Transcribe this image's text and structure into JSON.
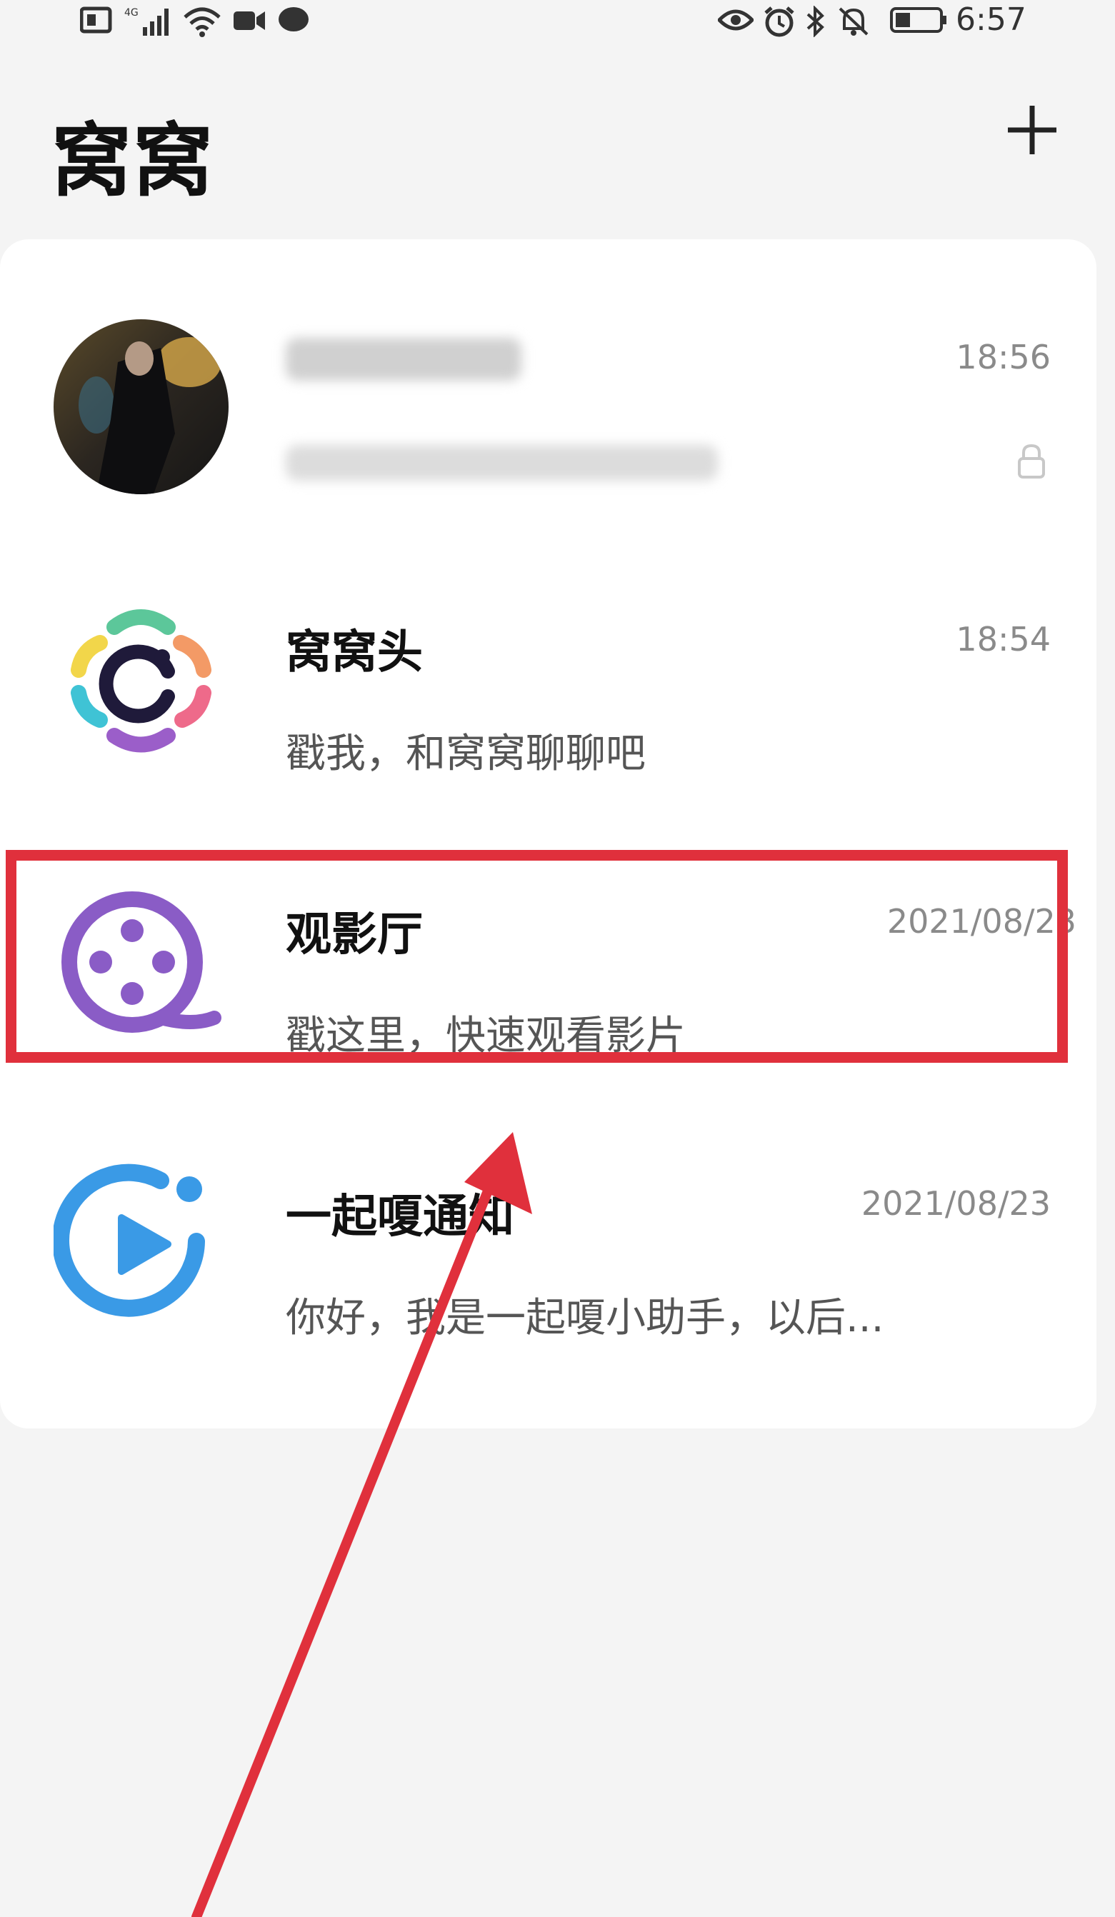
{
  "status_bar": {
    "time": "6:57"
  },
  "header": {
    "title": "窝窝"
  },
  "chats": [
    {
      "name": "",
      "time": "18:56",
      "preview": "",
      "locked": true
    },
    {
      "name": "窝窝头",
      "time": "18:54",
      "preview": "戳我，和窝窝聊聊吧"
    },
    {
      "name": "观影厅",
      "time": "2021/08/23",
      "preview": "戳这里，快速观看影片"
    },
    {
      "name": "一起嗄通知",
      "time": "2021/08/23",
      "preview": "你好，我是一起嗄小助手，以后..."
    }
  ],
  "colors": {
    "highlight": "#e0303c",
    "movie_icon": "#8a5cc6",
    "notify_icon": "#3a9ae6"
  }
}
